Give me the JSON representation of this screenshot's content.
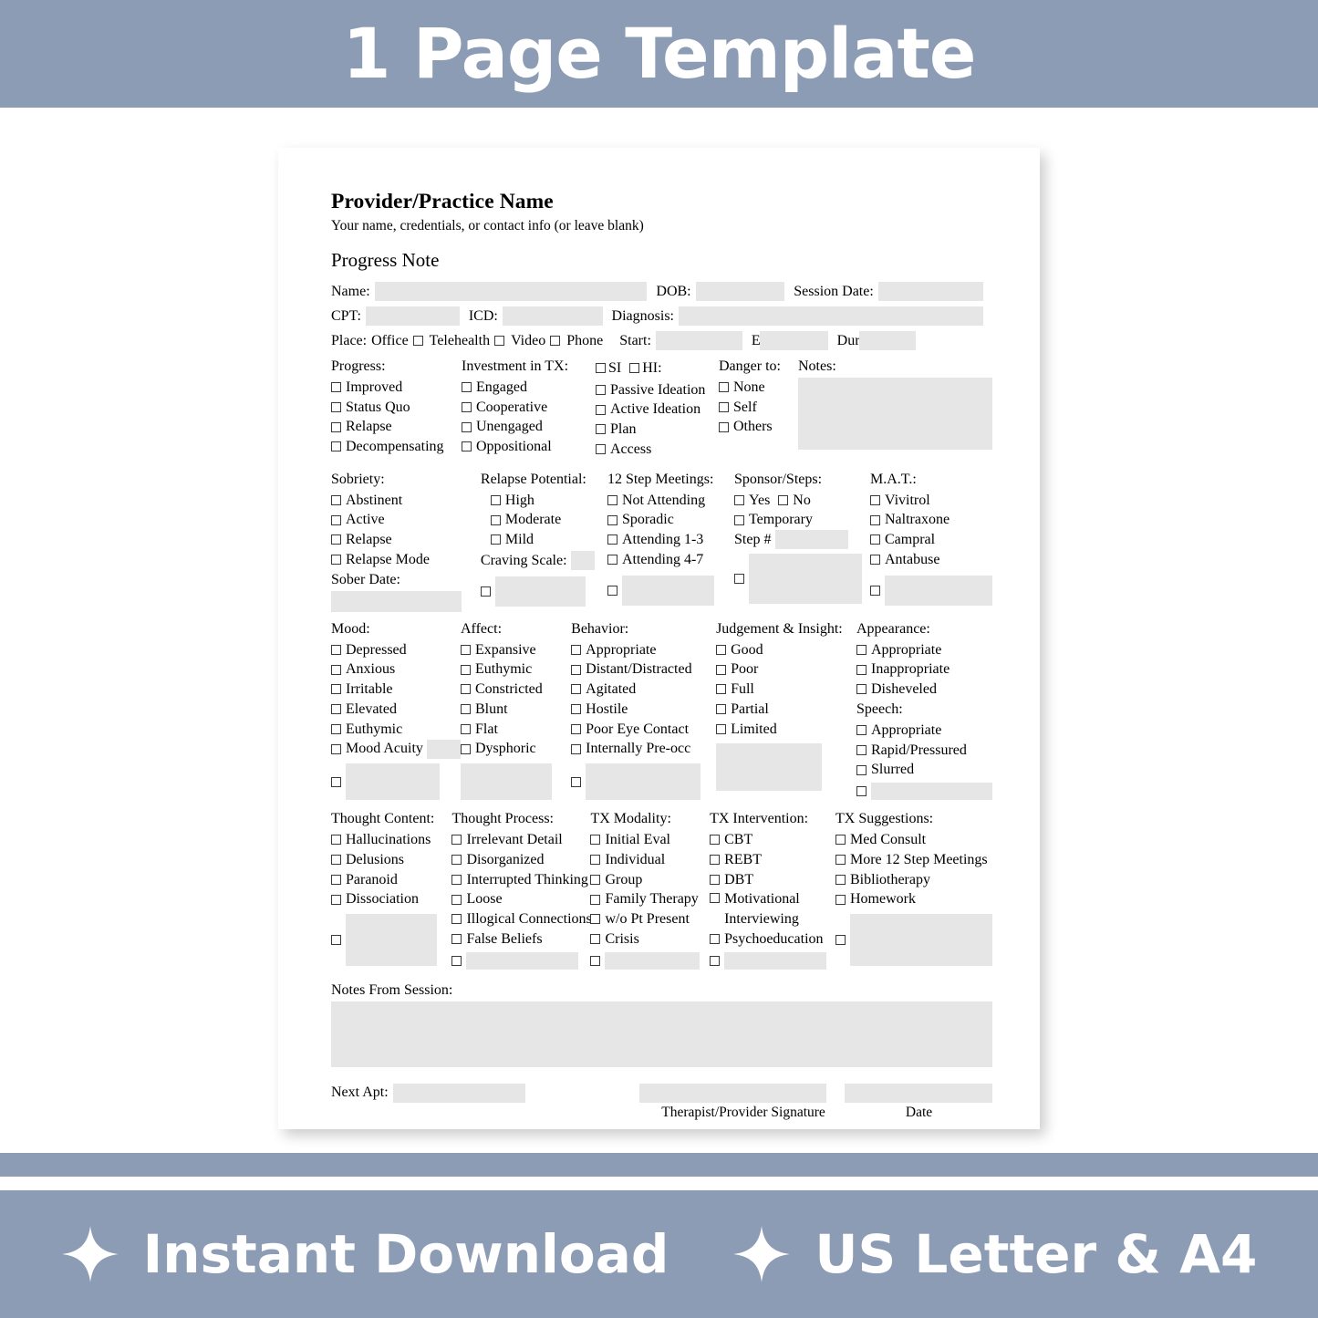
{
  "promo": {
    "top_text": "1 Page Template",
    "bottom_left_text": "Instant Download",
    "bottom_right_text": "US Letter & A4",
    "banner_color": "#8d9cb5",
    "field_color": "#e6e6e6"
  },
  "form": {
    "provider_name": "Provider/Practice Name",
    "provider_sub": "Your name, credentials, or contact info (or leave blank)",
    "title": "Progress Note",
    "identity": {
      "name_label": "Name:",
      "dob_label": "DOB:",
      "session_date_label": "Session Date:",
      "cpt_label": "CPT:",
      "icd_label": "ICD:",
      "diagnosis_label": "Diagnosis:"
    },
    "place": {
      "label": "Place:",
      "options": [
        "Office",
        "Telehealth",
        "Video",
        "Phone"
      ],
      "start_label": "Start:",
      "end_label": "End",
      "duration_label": "Durati"
    },
    "progress": {
      "heading": "Progress:",
      "options": [
        "Improved",
        "Status Quo",
        "Relapse",
        "Decompensating"
      ]
    },
    "investment": {
      "heading": "Investment in TX:",
      "options": [
        "Engaged",
        "Cooperative",
        "Unengaged",
        "Oppositional"
      ]
    },
    "ideation": {
      "si_label": "SI",
      "hi_label": "HI:",
      "options": [
        "Passive Ideation",
        "Active Ideation",
        "Plan",
        "Access"
      ]
    },
    "danger": {
      "heading": "Danger to:",
      "options": [
        "None",
        "Self",
        "Others"
      ]
    },
    "notes_box": {
      "heading": "Notes:"
    },
    "sobriety": {
      "heading": "Sobriety:",
      "options": [
        "Abstinent",
        "Active",
        "Relapse",
        "Relapse Mode"
      ],
      "sober_date_label": "Sober Date:"
    },
    "relapse_potential": {
      "heading": "Relapse Potential:",
      "options": [
        "High",
        "Moderate",
        "Mild"
      ],
      "craving_label": "Craving Scale:"
    },
    "twelve_step": {
      "heading": "12 Step Meetings:",
      "options": [
        "Not Attending",
        "Sporadic",
        "Attending 1-3",
        "Attending 4-7"
      ]
    },
    "sponsor": {
      "heading": "Sponsor/Steps:",
      "yes": "Yes",
      "no": "No",
      "temporary": "Temporary",
      "step_label": "Step #"
    },
    "mat": {
      "heading": "M.A.T.:",
      "options": [
        "Vivitrol",
        "Naltraxone",
        "Campral",
        "Antabuse"
      ]
    },
    "mood": {
      "heading": "Mood:",
      "options": [
        "Depressed",
        "Anxious",
        "Irritable",
        "Elevated",
        "Euthymic",
        "Mood Acuity"
      ]
    },
    "affect": {
      "heading": "Affect:",
      "options": [
        "Expansive",
        "Euthymic",
        "Constricted",
        "Blunt",
        "Flat",
        "Dysphoric"
      ]
    },
    "behavior": {
      "heading": "Behavior:",
      "options": [
        "Appropriate",
        "Distant/Distracted",
        "Agitated",
        "Hostile",
        "Poor Eye Contact",
        "Internally Pre-occ"
      ]
    },
    "judgement": {
      "heading": "Judgement & Insight:",
      "options": [
        "Good",
        "Poor",
        "Full",
        "Partial",
        "Limited"
      ]
    },
    "appearance": {
      "heading": "Appearance:",
      "options": [
        "Appropriate",
        "Inappropriate",
        "Disheveled"
      ]
    },
    "speech": {
      "heading": "Speech:",
      "options": [
        "Appropriate",
        "Rapid/Pressured",
        "Slurred"
      ]
    },
    "thought_content": {
      "heading": "Thought Content:",
      "options": [
        "Hallucinations",
        "Delusions",
        "Paranoid",
        "Dissociation"
      ]
    },
    "thought_process": {
      "heading": "Thought Process:",
      "options": [
        "Irrelevant Detail",
        "Disorganized",
        "Interrupted Thinking",
        "Loose",
        "Illogical Connections",
        "False Beliefs"
      ]
    },
    "tx_modality": {
      "heading": "TX Modality:",
      "options": [
        "Initial Eval",
        "Individual",
        "Group",
        "Family Therapy",
        "w/o Pt Present",
        "Crisis"
      ]
    },
    "tx_intervention": {
      "heading": "TX Intervention:",
      "options": [
        "CBT",
        "REBT",
        "DBT",
        "Motivational Interviewing",
        "Psychoeducation"
      ]
    },
    "tx_suggestions": {
      "heading": "TX Suggestions:",
      "options": [
        "Med Consult",
        "More 12 Step Meetings",
        "Bibliotherapy",
        "Homework"
      ]
    },
    "session_notes_label": "Notes From Session:",
    "next_apt_label": "Next Apt:",
    "signature_label": "Therapist/Provider Signature",
    "date_label": "Date"
  }
}
